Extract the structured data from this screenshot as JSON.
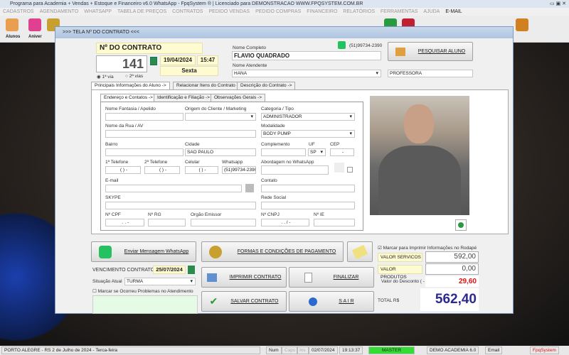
{
  "window": {
    "title": "Programa para Academia + Vendas + Estoque e Financeiro v6.0 WhatsApp - FpqSystem ® | Licenciado para  DEMONSTRACAO WWW.FPQSYSTEM.COM.BR"
  },
  "menu": [
    "CADASTROS",
    "AGENDAMENTO",
    "WHATSAPP",
    "TABELA DE PREÇOS",
    "CONTRATOS",
    "PEDIDO VENDAS",
    "PEDIDO COMPRAS",
    "FINANCEIRO",
    "RELATÓRIOS",
    "FERRAMENTAS",
    "AJUDA",
    "E-MAIL"
  ],
  "toolbar": {
    "alunos": "Alunos",
    "aniver": "Aniver"
  },
  "dialog": {
    "title": ">>>   TELA Nº DO CONTRATO   <<<",
    "contract_label": "Nº DO CONTRATO",
    "contract_number": "141",
    "date": "19/04/2024",
    "time": "15:47",
    "weekday": "Sexta",
    "via1": "1ª via",
    "via2": "2ª vias",
    "nome_completo_label": "Nome Completo",
    "nome_completo": "FLAVIO QUADRADO",
    "whatsapp_top": "(51)99734-2390",
    "atendente_label": "Nome Atendente",
    "atendente": "HANA",
    "cargo": "PROFESSORA",
    "pesquisar": "PESQUISAR ALUNO",
    "tabs": [
      "Principais Informações do Aluno ->",
      "Relacionar Itens do Contrato ->",
      "Descrição do Contrato ->"
    ],
    "subtabs": [
      "Endereço e Contatos ->",
      "Identificação e Filiação ->",
      "Observações Gerais ->"
    ],
    "fields": {
      "apelido": "Nome Fantasia / Apelido",
      "origem": "Origem do Cliente / Marketing",
      "categoria": "Categoria / Tipo",
      "categoria_val": "ADMINISTRADOR",
      "rua": "Nome da Rua / AV",
      "modalidade": "Modalidade",
      "modalidade_val": "BODY PUMP",
      "bairro": "Bairro",
      "cidade": "Cidade",
      "cidade_val": "SAO PAULO",
      "complemento": "Complemento",
      "uf": "UF",
      "uf_val": "SP",
      "cep": "CEP",
      "cep_val": "-",
      "tel1": "1ª Telefone",
      "tel2": "2ª Telefone",
      "celular": "Celular",
      "whatsapp": "Whatsapp",
      "phone_mask": "(  )    -",
      "whatsapp_val": "(51)99734-2390",
      "abordagem": "Abordagem no WhatsApp",
      "email": "E-mail",
      "contato": "Contato",
      "skype": "SKYPE",
      "rede": "Rede Social",
      "cpf": "Nº CPF",
      "cpf_mask": ".   .   -",
      "rg": "Nº RG",
      "orgao": "Orgão Emissor",
      "cnpj": "Nº CNPJ",
      "cnpj_mask": ".   .   /   -",
      "ie": "Nº IE"
    },
    "whatsapp_btn": "Enviar Mensagem WhatsApp",
    "pagamento_btn": "FORMAS E CONDIÇÕES DE PAGAMENTO",
    "vencimento_label": "VENCIMENTO CONTRATO:",
    "vencimento": "25/07/2024",
    "situacao_label": "Situação Atual",
    "situacao": "TURMA",
    "problemas": "Marcar se Ocorreu Problemas no Atendimento",
    "imprimir": "IMPRIMIR CONTRATO",
    "finalizar": "FINALIZAR",
    "salvar": "SALVAR  CONTRATO",
    "sair": "S A I R",
    "rodape": "Marcar para Imprimir Informações no Rodapé",
    "servicos_label": "VALOR SERVICOS",
    "servicos": "592,00",
    "produtos_label": "VALOR PRODUTOS",
    "produtos": "0,00",
    "desconto_label": "Valor do Desconto ( - )",
    "desconto": "29,60",
    "total_label": "TOTAL R$",
    "total": "562,40"
  },
  "status": {
    "location": "PORTO ALEGRE - RS  2 de Julho de 2024 - Terca-feira",
    "num": "Num",
    "caps": "Caps",
    "ins": "Ins",
    "date": "02/07/2024",
    "time": "19:13:37",
    "user": "MASTER",
    "company": "DEMO ACADEMIA 6.0",
    "email": "Email",
    "brand": "FpqSystem"
  },
  "colors": {
    "accent": "#2b2b8f",
    "discount": "#e01010",
    "master": "#33dd33"
  }
}
